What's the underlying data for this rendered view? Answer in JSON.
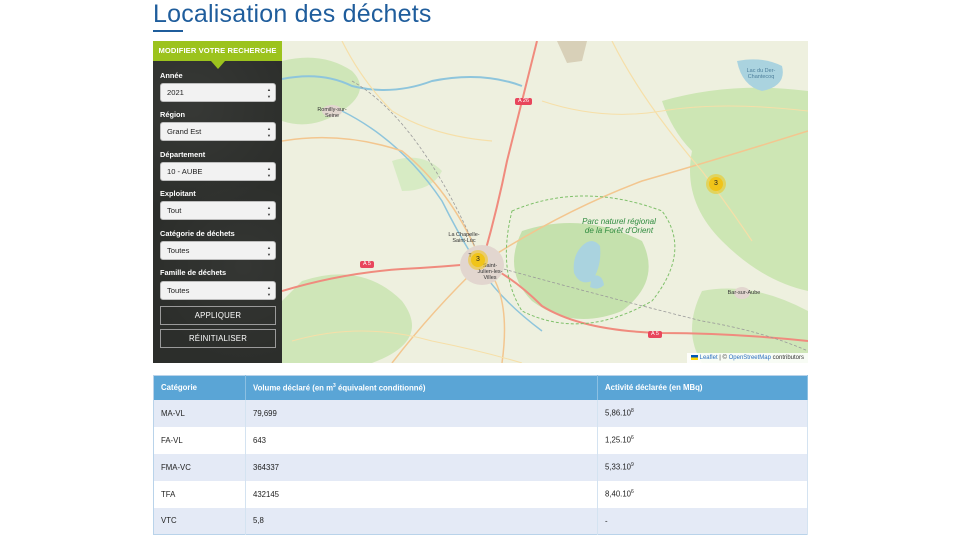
{
  "page": {
    "title": "Localisation des déchets"
  },
  "search": {
    "header": "MODIFIER VOTRE RECHERCHE",
    "fields": [
      {
        "label": "Année",
        "value": "2021"
      },
      {
        "label": "Région",
        "value": "Grand Est"
      },
      {
        "label": "Département",
        "value": "10 - AUBE"
      },
      {
        "label": "Exploitant",
        "value": "Tout"
      },
      {
        "label": "Catégorie de déchets",
        "value": "Toutes"
      },
      {
        "label": "Famille de déchets",
        "value": "Toutes"
      }
    ],
    "apply_label": "APPLIQUER",
    "reset_label": "RÉINITIALISER"
  },
  "map": {
    "places": {
      "romilly": "Romilly-sur-Seine",
      "chapelle": "La Chapelle-Saint-Luc",
      "troyes": "T",
      "stjulien": "Saint-Julien-les-Villes",
      "bar": "Bar-sur-Aube",
      "lac": "Lac du Der-Chantecoq"
    },
    "park_label": "Parc naturel régional de la Forêt d'Orient",
    "roads": {
      "a26": "A 26",
      "a5_west": "A 5",
      "a5_east": "A 5"
    },
    "clusters": [
      {
        "count": "3"
      },
      {
        "count": "3"
      }
    ],
    "attribution": {
      "leaflet": "Leaflet",
      "sep": " | © ",
      "osm": "OpenStreetMap",
      "suffix": " contributors"
    }
  },
  "table": {
    "headers": {
      "category": "Catégorie",
      "volume_prefix": "Volume déclaré (en m",
      "volume_sup": "3",
      "volume_suffix": " équivalent conditionné)",
      "activity": "Activité déclarée (en MBq)"
    },
    "rows": [
      {
        "category": "MA-VL",
        "volume": "79,699",
        "activity": "5,86.10",
        "activity_exp": "8"
      },
      {
        "category": "FA-VL",
        "volume": "643",
        "activity": "1,25.10",
        "activity_exp": "6"
      },
      {
        "category": "FMA-VC",
        "volume": "364337",
        "activity": "5,33.10",
        "activity_exp": "9"
      },
      {
        "category": "TFA",
        "volume": "432145",
        "activity": "8,40.10",
        "activity_exp": "6"
      },
      {
        "category": "VTC",
        "volume": "5,8",
        "activity": "-",
        "activity_exp": ""
      }
    ]
  },
  "colors": {
    "title": "#1f5d9c",
    "panel_header": "#9cc31d",
    "panel_bg": "#2c2e2b",
    "table_header": "#5aa5d6",
    "table_row_alt": "#e4eaf6",
    "cluster": "#f0c419"
  }
}
